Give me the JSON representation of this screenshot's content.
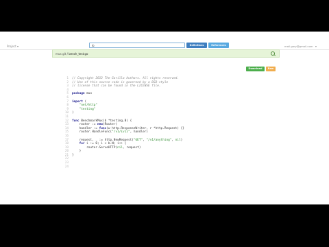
{
  "header": {
    "project_selector": "Project ▾",
    "search": {
      "value": "lo"
    },
    "buttons": {
      "definitions": "Definitions",
      "references": "References"
    },
    "user": "mail.gary@gmail.com",
    "user_caret": "▾"
  },
  "pathbar": {
    "repo": "mux.git",
    "sep": " / ",
    "file": "bench_test.go"
  },
  "actions": {
    "download": "Download",
    "raw": "Raw"
  },
  "code": {
    "line_numbers": [
      "1",
      "2",
      "3",
      "4",
      "5",
      "6",
      "7",
      "8",
      "9",
      "10",
      "11",
      "12",
      "13",
      "14",
      "15",
      "16",
      "17",
      "18",
      "19",
      "20",
      "21",
      "22",
      "23",
      "24"
    ],
    "lines": [
      "// Copyright 2012 The Gorilla Authors. All rights reserved.",
      "// Use of this source code is governed by a BSD-style",
      "// license that can be found in the LICENSE file.",
      "",
      "package mux",
      "",
      "import (",
      "    \"net/http\"",
      "    \"testing\"",
      ")",
      "",
      "func BenchmarkMux(b *testing.B) {",
      "    router := new(Router)",
      "    handler := func(w http.ResponseWriter, r *http.Request) {}",
      "    router.HandleFunc(\"/v1/{v1}\", handler)",
      "",
      "    request, _ := http.NewRequest(\"GET\", \"/v1/anything\", nil)",
      "    for i := 0; i < b.N; i++ {",
      "        router.ServeHTTP(nil, request)",
      "    }",
      "}",
      "",
      "",
      ""
    ]
  },
  "colors": {
    "comment": "#888888",
    "keyword": "#1a1a8c",
    "string": "#2e8b2e",
    "pathbar_bg": "#e6f4d8",
    "definitions_btn": "#3f7fc0",
    "references_btn": "#59a9e0",
    "download_btn": "#4cae4c",
    "raw_btn": "#f0ad4e"
  }
}
